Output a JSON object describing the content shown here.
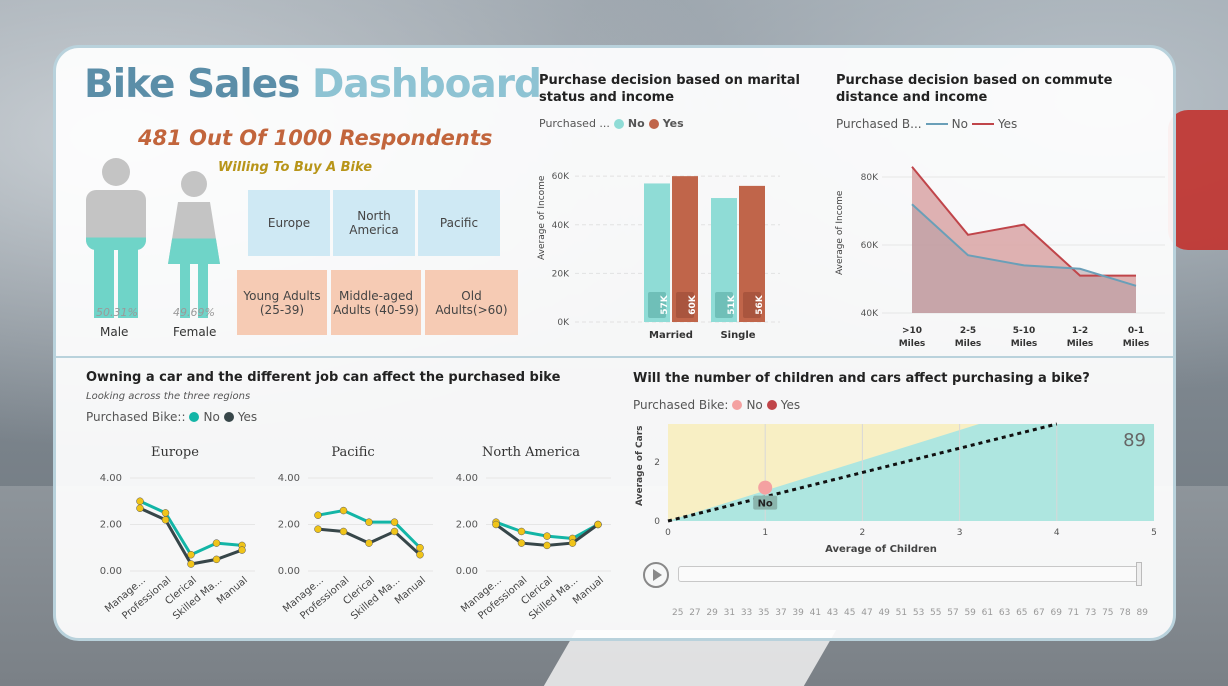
{
  "title": {
    "part1": "Bike Sales",
    "part2": "Dashboard"
  },
  "respondents": "481 Out Of 1000 Respondents",
  "willing": "Willing To Buy A Bike",
  "gender": {
    "male": {
      "label": "Male",
      "pct": "50.31%",
      "fill": 0.5031
    },
    "female": {
      "label": "Female",
      "pct": "49.69%",
      "fill": 0.4969
    }
  },
  "regions": [
    "Europe",
    "North America",
    "Pacific"
  ],
  "ages": [
    "Young Adults (25-39)",
    "Middle-aged Adults (40-59)",
    "Old Adults(>60)"
  ],
  "marital_chart": {
    "title": "Purchase decision based on marital status and income",
    "legend_label": "Purchased ...",
    "legend": [
      "No",
      "Yes"
    ],
    "ylabel": "Average of Income",
    "yticks": [
      "0K",
      "20K",
      "40K",
      "60K"
    ],
    "categories": [
      "Married",
      "Single"
    ]
  },
  "commute_chart": {
    "title": "Purchase decision based on commute distance and income",
    "legend_label": "Purchased B...",
    "legend": [
      "No",
      "Yes"
    ],
    "ylabel": "Average of Income",
    "yticks": [
      "40K",
      "60K",
      "80K"
    ],
    "categories": [
      ">10 Miles",
      "2-5 Miles",
      "5-10 Miles",
      "1-2 Miles",
      "0-1 Miles"
    ]
  },
  "job_chart": {
    "title": "Owning a car and the different job can affect the purchased bike",
    "subtitle": "Looking across the three regions",
    "legend_label": "Purchased Bike::",
    "legend": [
      "No",
      "Yes"
    ],
    "yticks": [
      "0.00",
      "2.00",
      "4.00"
    ]
  },
  "children_chart": {
    "title": "Will the number of children and cars affect purchasing a bike?",
    "legend_label": "Purchased Bike:",
    "legend": [
      "No",
      "Yes"
    ],
    "ylabel": "Average of Cars",
    "xlabel": "Average of Children",
    "xticks": [
      "0",
      "1",
      "2",
      "3",
      "4",
      "5"
    ],
    "yticks": [
      "0",
      "2"
    ],
    "point_label": "No",
    "age_value": "89",
    "slider_ticks": [
      "25",
      "27",
      "29",
      "31",
      "33",
      "35",
      "37",
      "39",
      "41",
      "43",
      "45",
      "47",
      "49",
      "51",
      "53",
      "55",
      "57",
      "59",
      "61",
      "63",
      "65",
      "67",
      "69",
      "71",
      "73",
      "75",
      "78",
      "89"
    ]
  },
  "colors": {
    "no": "#8fdcd6",
    "yes": "#c0654a",
    "no_line": "#6a9fb8",
    "yes_line": "#c0454a",
    "teal": "#13b5a6",
    "dark": "#374649"
  },
  "chart_data": [
    {
      "type": "bar",
      "title": "Purchase decision based on marital status and income",
      "ylabel": "Average of Income",
      "categories": [
        "Married",
        "Single"
      ],
      "series": [
        {
          "name": "No",
          "values": [
            57,
            51
          ],
          "labels": [
            "57K",
            "51K"
          ]
        },
        {
          "name": "Yes",
          "values": [
            60,
            56
          ],
          "labels": [
            "60K",
            "56K"
          ]
        }
      ],
      "ylim": [
        0,
        65
      ]
    },
    {
      "type": "area",
      "title": "Purchase decision based on commute distance and income",
      "ylabel": "Average of Income",
      "categories": [
        ">10 Miles",
        "2-5 Miles",
        "5-10 Miles",
        "1-2 Miles",
        "0-1 Miles"
      ],
      "series": [
        {
          "name": "No",
          "values": [
            72,
            57,
            54,
            53,
            48
          ]
        },
        {
          "name": "Yes",
          "values": [
            83,
            63,
            66,
            51,
            51
          ]
        }
      ],
      "ylim": [
        40,
        85
      ]
    },
    {
      "type": "line",
      "title": "Europe",
      "categories": [
        "Manage...",
        "Professional",
        "Clerical",
        "Skilled Ma...",
        "Manual"
      ],
      "series": [
        {
          "name": "No",
          "values": [
            3.0,
            2.5,
            0.7,
            1.2,
            1.1
          ]
        },
        {
          "name": "Yes",
          "values": [
            2.7,
            2.2,
            0.3,
            0.5,
            0.9
          ]
        }
      ],
      "ylim": [
        0,
        4
      ]
    },
    {
      "type": "line",
      "title": "Pacific",
      "categories": [
        "Manage...",
        "Professional",
        "Clerical",
        "Skilled Ma...",
        "Manual"
      ],
      "series": [
        {
          "name": "No",
          "values": [
            2.4,
            2.6,
            2.1,
            2.1,
            1.0
          ]
        },
        {
          "name": "Yes",
          "values": [
            1.8,
            1.7,
            1.2,
            1.7,
            0.7
          ]
        }
      ],
      "ylim": [
        0,
        4
      ]
    },
    {
      "type": "line",
      "title": "North America",
      "categories": [
        "Manage...",
        "Professional",
        "Clerical",
        "Skilled Ma...",
        "Manual"
      ],
      "series": [
        {
          "name": "No",
          "values": [
            2.1,
            1.7,
            1.5,
            1.4,
            2.0
          ]
        },
        {
          "name": "Yes",
          "values": [
            2.0,
            1.2,
            1.1,
            1.2,
            2.0
          ]
        }
      ],
      "ylim": [
        0,
        4
      ]
    },
    {
      "type": "scatter",
      "title": "Will the number of children and cars affect purchasing a bike?",
      "xlabel": "Average of Children",
      "ylabel": "Average of Cars",
      "points": [
        {
          "series": "No",
          "x": 1.0,
          "y": 1.0
        }
      ],
      "trend": {
        "from": [
          0,
          0
        ],
        "to": [
          4,
          3.3
        ]
      },
      "xlim": [
        0,
        5
      ],
      "ylim": [
        0,
        3.3
      ]
    }
  ]
}
